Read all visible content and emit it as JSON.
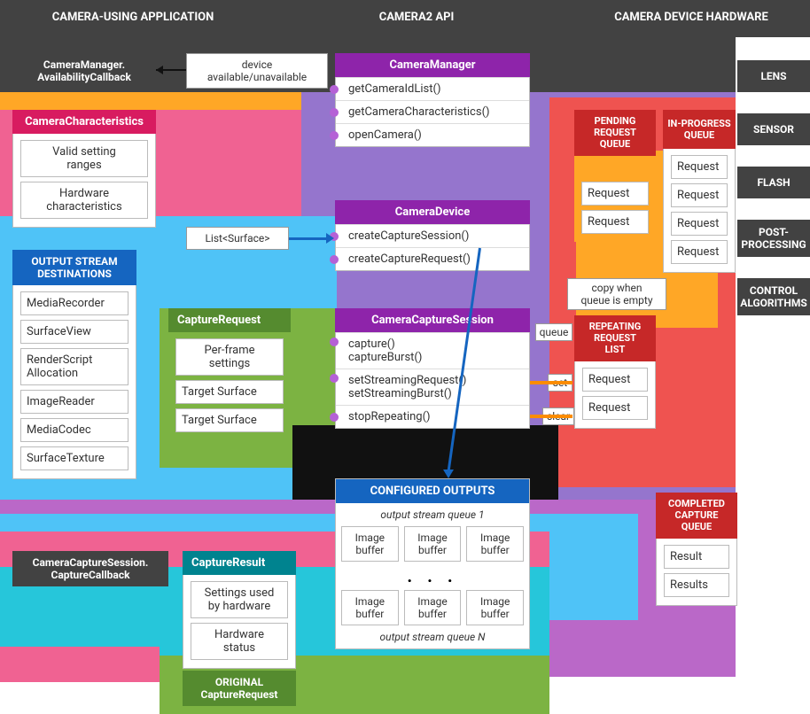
{
  "columns": {
    "app": "CAMERA-USING APPLICATION",
    "api": "CAMERA2 API",
    "hw": "CAMERA DEVICE HARDWARE"
  },
  "hardware": {
    "lens": "LENS",
    "sensor": "SENSOR",
    "flash": "FLASH",
    "post": "POST-\nPROCESSING",
    "control": "CONTROL\nALGORITHMS"
  },
  "availability_cb": "CameraManager.\nAvailabilityCallback",
  "device_avail": "device\navailable/unavailable",
  "camera_characteristics": {
    "title": "CameraCharacteristics",
    "item1": "Valid setting\nranges",
    "item2": "Hardware\ncharacteristics"
  },
  "camera_manager": {
    "title": "CameraManager",
    "m1": "getCameraIdList()",
    "m2": "getCameraCharacteristics()",
    "m3": "openCamera()"
  },
  "camera_device": {
    "title": "CameraDevice",
    "m1": "createCaptureSession()",
    "m2": "createCaptureRequest()"
  },
  "list_surface": "List<Surface>",
  "output_stream": {
    "title": "OUTPUT STREAM\nDESTINATIONS",
    "i1": "MediaRecorder",
    "i2": "SurfaceView",
    "i3": "RenderScript\nAllocation",
    "i4": "ImageReader",
    "i5": "MediaCodec",
    "i6": "SurfaceTexture"
  },
  "capture_request": {
    "title": "CaptureRequest",
    "i1": "Per-frame\nsettings",
    "i2": "Target Surface",
    "i3": "Target Surface"
  },
  "camera_session": {
    "title": "CameraCaptureSession",
    "m1": "capture()",
    "m2": "captureBurst()",
    "m3": "setStreamingRequest()",
    "m4": "setStreamingBurst()",
    "m5": "stopRepeating()"
  },
  "pending_q": {
    "title": "PENDING\nREQUEST\nQUEUE",
    "item": "Request"
  },
  "inprog_q": {
    "title": "IN-PROGRESS\nQUEUE",
    "item": "Request"
  },
  "repeating": {
    "title": "REPEATING\nREQUEST\nLIST",
    "item": "Request"
  },
  "copy_empty": "copy when\nqueue is empty",
  "queue_lbl": "queue",
  "set_lbl": "set",
  "clear_lbl": "clear",
  "configured": {
    "title": "CONFIGURED OUTPUTS",
    "q1": "output stream queue 1",
    "qn": "output stream queue N",
    "buf": "Image\nbuffer",
    "dots": ". . ."
  },
  "capture_cb": "CameraCaptureSession.\nCaptureCallback",
  "capture_result": {
    "title": "CaptureResult",
    "i1": "Settings used\nby hardware",
    "i2": "Hardware\nstatus"
  },
  "original_cr": "ORIGINAL\nCaptureRequest",
  "completed_q": {
    "title": "COMPLETED\nCAPTURE\nQUEUE",
    "i1": "Result",
    "i2": "Results"
  }
}
